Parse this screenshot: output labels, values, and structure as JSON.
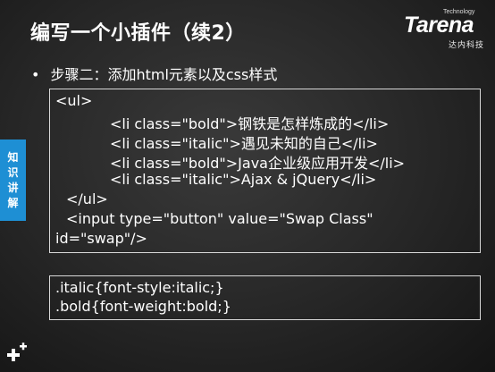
{
  "slide": {
    "title": "编写一个小插件（续2）",
    "bullet": "步骤二：添加html元素以及css样式",
    "side_tab": [
      "知",
      "识",
      "讲",
      "解"
    ]
  },
  "logo": {
    "tech": "Technology",
    "word": "Tarena",
    "sub": "达内科技"
  },
  "code": {
    "lines": [
      "<ul>",
      "<li class=\"bold\">钢铁是怎样炼成的</li>",
      "<li class=\"italic\">遇见未知的自己</li>",
      "<li class=\"bold\">Java企业级应用开发</li>",
      "<li class=\"italic\">Ajax & jQuery</li>",
      "</ul>",
      "<input type=\"button\" value=\"Swap Class\"",
      "id=\"swap\"/>"
    ]
  },
  "css": {
    "lines": [
      ".italic{font-style:italic;}",
      ".bold{font-weight:bold;}"
    ]
  },
  "icons": {
    "bullet": "bullet-dot-icon",
    "corner": "plus-icon"
  }
}
